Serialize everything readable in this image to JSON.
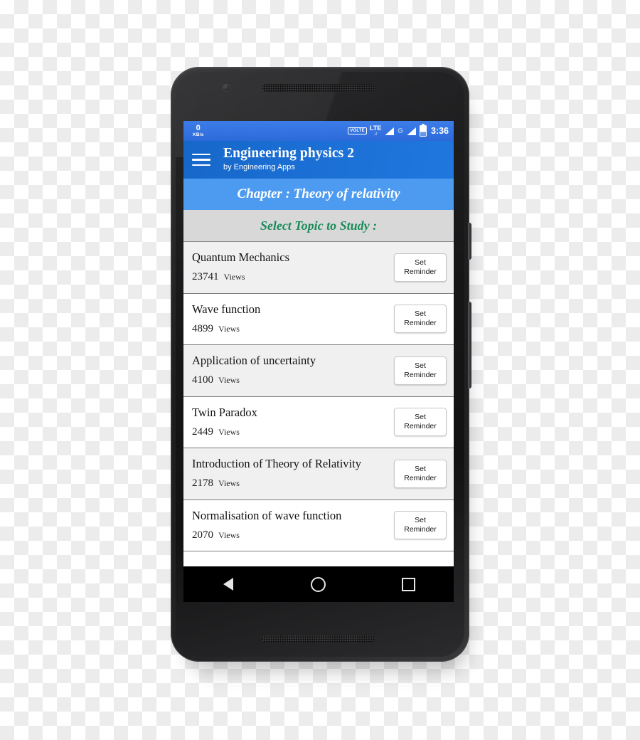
{
  "status_bar": {
    "net_speed_value": "0",
    "net_speed_unit": "KB/s",
    "volte_label": "VOLTE",
    "lte_label": "LTE",
    "lte_arrows": "↓↑",
    "gprs_label": "G",
    "clock": "3:36",
    "background_color": "#2c6ad9"
  },
  "app_bar": {
    "menu_icon": "hamburger-icon",
    "title": "Engineering physics 2",
    "subtitle": "by Engineering Apps",
    "background_color": "#1b6fd4"
  },
  "chapter_band": {
    "text": "Chapter : Theory of relativity",
    "background_color": "#4d9bf0",
    "text_color": "#ffffff"
  },
  "select_band": {
    "text": "Select Topic to Study :",
    "background_color": "#d8d8d8",
    "text_color": "#1a8c5a"
  },
  "topic_list": {
    "views_label": "Views",
    "reminder_button": {
      "line1": "Set",
      "line2": "Reminder"
    },
    "items": [
      {
        "title": "Quantum Mechanics",
        "views": "23741"
      },
      {
        "title": "Wave function",
        "views": "4899"
      },
      {
        "title": "Application of uncertainty",
        "views": "4100"
      },
      {
        "title": "Twin Paradox",
        "views": "2449"
      },
      {
        "title": "Introduction of Theory of Relativity",
        "views": "2178"
      },
      {
        "title": "Normalisation of wave function",
        "views": "2070"
      }
    ]
  },
  "nav_bar": {
    "back_label": "Back",
    "home_label": "Home",
    "recents_label": "Recents",
    "background_color": "#000000"
  }
}
